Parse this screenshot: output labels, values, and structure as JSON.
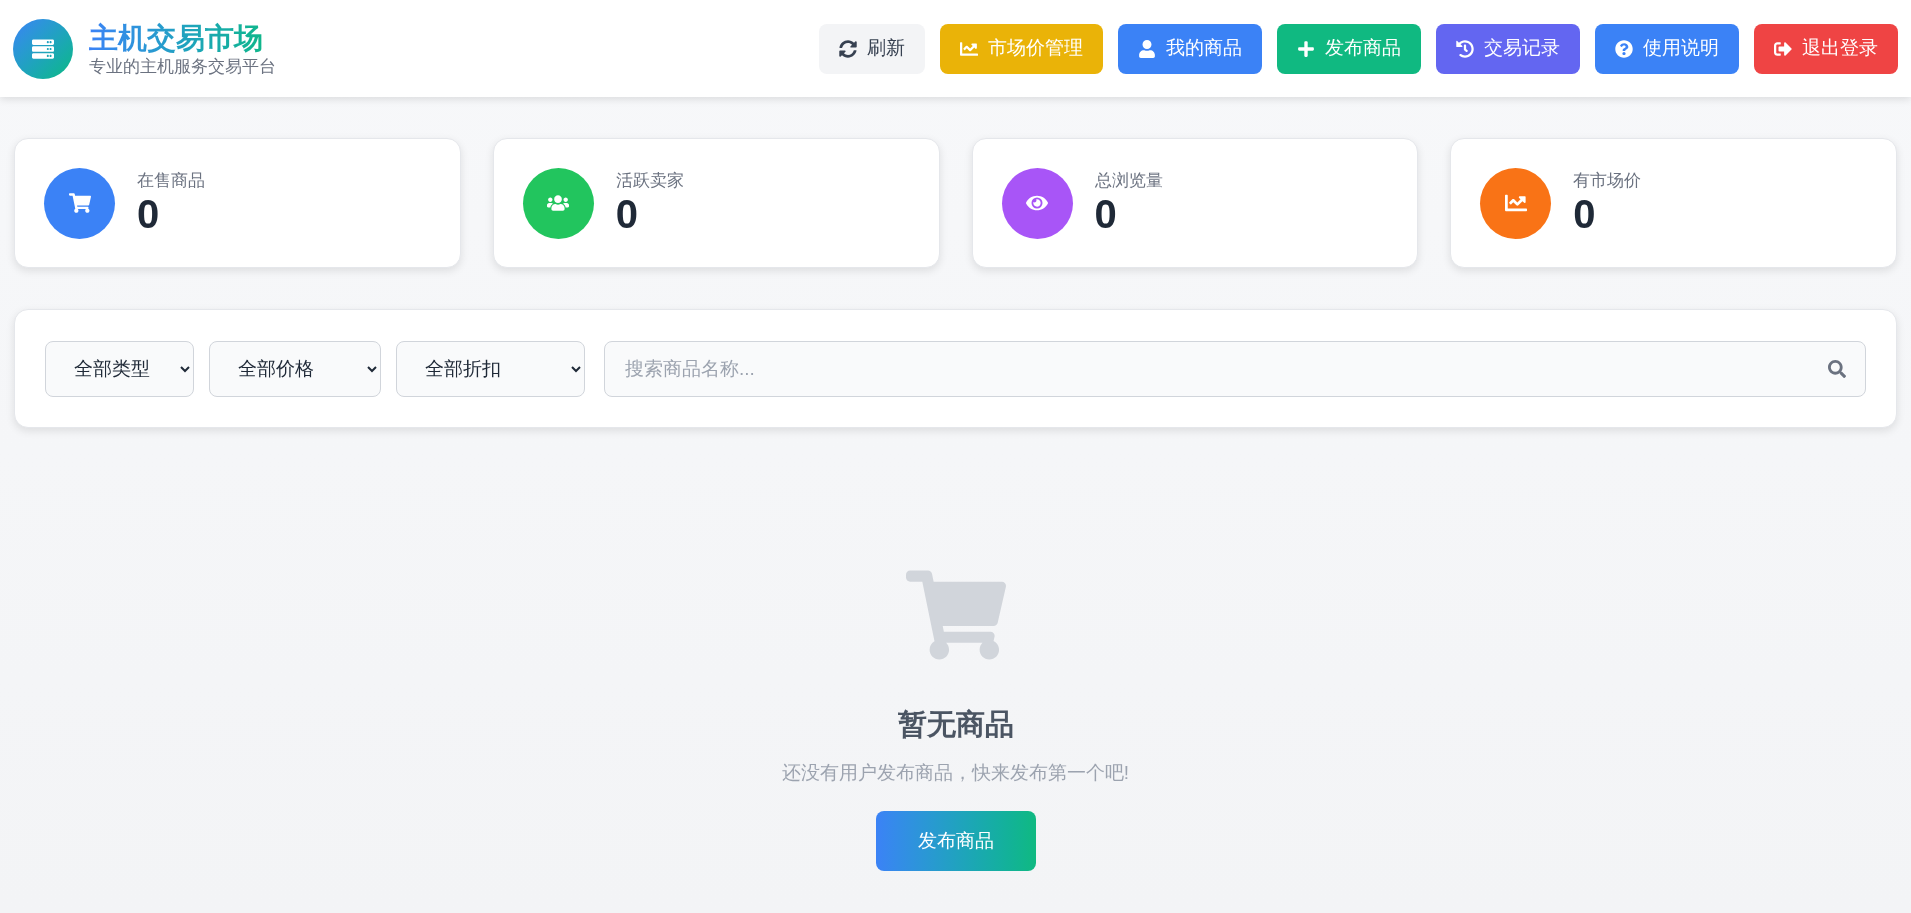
{
  "header": {
    "title": "主机交易市场",
    "subtitle": "专业的主机服务交易平台"
  },
  "nav_buttons": [
    {
      "label": "刷新",
      "kind": "secondary",
      "color": "#f3f4f6"
    },
    {
      "label": "市场价管理",
      "kind": "primary",
      "color": "#eab308"
    },
    {
      "label": "我的商品",
      "kind": "primary",
      "color": "#3b82f6"
    },
    {
      "label": "发布商品",
      "kind": "primary",
      "color": "#10b981"
    },
    {
      "label": "交易记录",
      "kind": "primary",
      "color": "#6366f1"
    },
    {
      "label": "使用说明",
      "kind": "primary",
      "color": "#3b82f6"
    },
    {
      "label": "退出登录",
      "kind": "primary",
      "color": "#ef4444"
    }
  ],
  "stats": [
    {
      "label": "在售商品",
      "value": "0",
      "color": "#3b82f6"
    },
    {
      "label": "活跃卖家",
      "value": "0",
      "color": "#22c55e"
    },
    {
      "label": "总浏览量",
      "value": "0",
      "color": "#a855f7"
    },
    {
      "label": "有市场价",
      "value": "0",
      "color": "#f97316"
    }
  ],
  "filters": [
    {
      "value": "全部类型"
    },
    {
      "value": "全部价格"
    },
    {
      "value": "全部折扣"
    }
  ],
  "search": {
    "placeholder": "搜索商品名称..."
  },
  "empty_state": {
    "title": "暂无商品",
    "message": "还没有用户发布商品，快来发布第一个吧!",
    "button": "发布商品"
  }
}
